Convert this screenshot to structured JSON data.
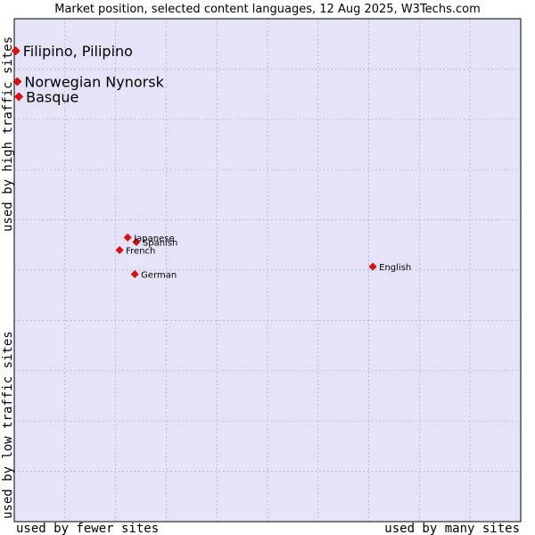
{
  "chart_data": {
    "type": "scatter",
    "title": "Market position, selected content languages, 12 Aug 2025, W3Techs.com",
    "xlabel_left": "used by fewer sites",
    "xlabel_right": "used by many sites",
    "ylabel_bottom": "used by low traffic sites",
    "ylabel_top": "used by high traffic sites",
    "xlim": [
      0,
      100
    ],
    "ylim": [
      0,
      100
    ],
    "grid": true,
    "colors": {
      "plot_bg": "#e4e4f8",
      "grid": "#9a9ab0",
      "marker": "#ff0000",
      "marker_edge": "#b00000",
      "frame": "#000000"
    },
    "points": [
      {
        "label": "Filipino, Pilipino",
        "x": 0.3,
        "y": 93.6,
        "emphasis": true
      },
      {
        "label": "Norwegian Nynorsk",
        "x": 0.6,
        "y": 87.5,
        "emphasis": true
      },
      {
        "label": "Basque",
        "x": 0.9,
        "y": 84.5,
        "emphasis": true
      },
      {
        "label": "Japanese",
        "x": 22.4,
        "y": 56.5,
        "emphasis": false
      },
      {
        "label": "Spanish",
        "x": 24.1,
        "y": 55.6,
        "emphasis": false
      },
      {
        "label": "French",
        "x": 20.8,
        "y": 54.0,
        "emphasis": false
      },
      {
        "label": "German",
        "x": 23.8,
        "y": 49.2,
        "emphasis": false
      },
      {
        "label": "English",
        "x": 70.8,
        "y": 50.7,
        "emphasis": false
      }
    ]
  }
}
